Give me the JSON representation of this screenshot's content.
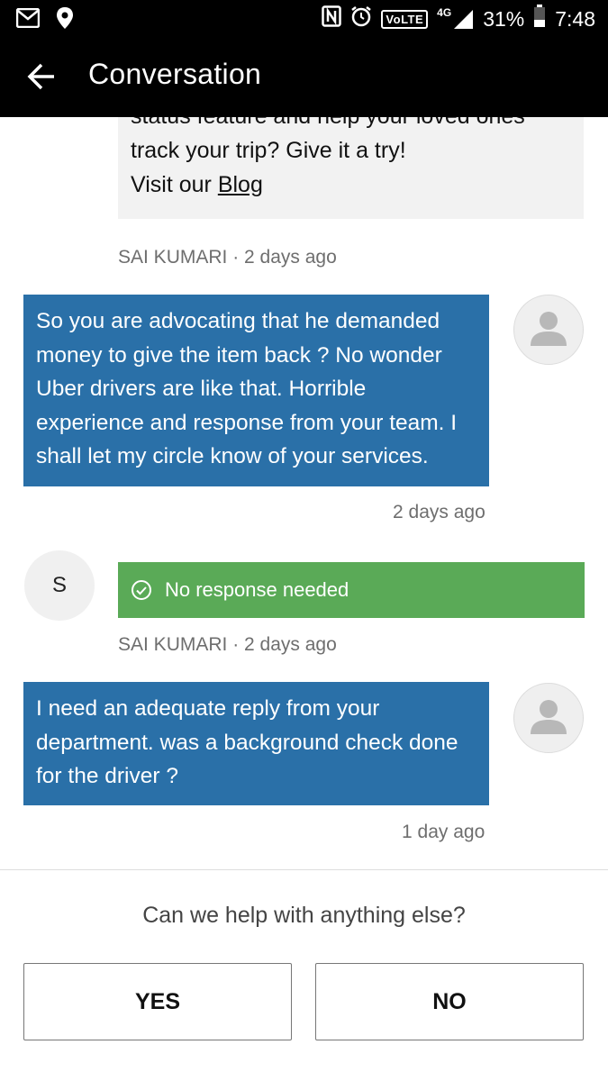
{
  "status_bar": {
    "icons_left": [
      "gmail-icon",
      "location-icon"
    ],
    "icons_right": [
      "nfc-icon",
      "alarm-icon",
      "volte-icon",
      "signal-icon",
      "battery-icon"
    ],
    "volte": "VoLTE",
    "network": "4G",
    "battery": "31%",
    "time": "7:48"
  },
  "app_bar": {
    "title": "Conversation"
  },
  "messages": {
    "m0_line1": "status feature and help your loved ones",
    "m0_line2": "track your trip? Give it a try!",
    "m0_line3_prefix": "Visit our ",
    "m0_link": "Blog",
    "m1_meta_name": "SAI KUMARI",
    "m1_meta_time": "2 days ago",
    "m1_text": "So you are advocating that he demanded money to give the item back ? No wonder Uber drivers are like that. Horrible experience and response from your team. I shall let my circle know of your services.",
    "m1_time": "2 days ago",
    "m2_avatar": "S",
    "m2_status": "No response needed",
    "m3_meta_name": "SAI KUMARI",
    "m3_meta_time": "2 days ago",
    "m3_text": "I need an adequate reply from your department. was a background check done for the driver ?",
    "m3_time": "1 day ago"
  },
  "meta_separator": " · ",
  "footer": {
    "question": "Can we help with anything else?",
    "yes_label": "YES",
    "no_label": "NO"
  },
  "colors": {
    "agent_bubble": "#f2f2f2",
    "user_bubble": "#2a70a8",
    "status_green": "#5aaa57",
    "app_bar": "#000000"
  }
}
